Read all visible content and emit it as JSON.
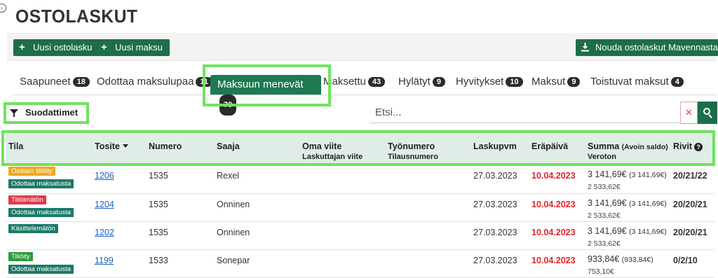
{
  "page": {
    "title": "OSTOLASKUT"
  },
  "toolbar": {
    "new_invoice": "Uusi ostolasku",
    "new_payment": "Uusi maksu",
    "fetch_label": "Nouda ostolaskut Mavennasta"
  },
  "tabs": [
    {
      "label": "Saapuneet",
      "count": "18"
    },
    {
      "label": "Odottaa maksulupaa",
      "count": "11"
    },
    {
      "label": "Maksuun menevät",
      "count": "70"
    },
    {
      "label": "Maksettu",
      "count": "43"
    },
    {
      "label": "Hylätyt",
      "count": "9"
    },
    {
      "label": "Hyvitykset",
      "count": "10"
    },
    {
      "label": "Maksut",
      "count": "9"
    },
    {
      "label": "Toistuvat maksut",
      "count": "4"
    }
  ],
  "filter": {
    "label": "Suodattimet"
  },
  "search": {
    "placeholder": "Etsi..."
  },
  "columns": {
    "tila": "Tila",
    "tosite": "Tosite",
    "numero": "Numero",
    "saaja": "Saaja",
    "oma_viite": "Oma viite",
    "laskuttajan_viite": "Laskuttajan viite",
    "tyonumero": "Työnumero",
    "tilausnumero": "Tilausnumero",
    "laskupvm": "Laskupvm",
    "erapaiva": "Eräpäivä",
    "summa": "Summa",
    "avoin_saldo": "(Avoin saldo)",
    "veroton": "Veroton",
    "rivit": "Rivit"
  },
  "rows": [
    {
      "statuses": [
        {
          "text": "Osittain tiliöity",
          "color": "#f0a81c"
        },
        {
          "text": "Odottaa maksatusta",
          "color": "#1d7a68"
        }
      ],
      "tosite": "1206",
      "numero": "1535",
      "saaja": "Rexel",
      "laskupvm": "27.03.2023",
      "erapaiva": "10.04.2023",
      "summa": "3 141,69€",
      "avoin": "(3 141,69€)",
      "veroton": "2 533,62€",
      "rivit": "20/21/22"
    },
    {
      "statuses": [
        {
          "text": "Tiliöimätön",
          "color": "#e0394a"
        },
        {
          "text": "Odottaa maksatusta",
          "color": "#1d7a68"
        }
      ],
      "tosite": "1204",
      "numero": "1535",
      "saaja": "Onninen",
      "laskupvm": "27.03.2023",
      "erapaiva": "10.04.2023",
      "summa": "3 141,69€",
      "avoin": "(3 141,69€)",
      "veroton": "2 533,62€",
      "rivit": "20/20/21"
    },
    {
      "statuses": [
        {
          "text": "Käsittelemätön",
          "color": "#1d7a68"
        }
      ],
      "tosite": "1202",
      "numero": "1535",
      "saaja": "Onninen",
      "laskupvm": "27.03.2023",
      "erapaiva": "10.04.2023",
      "summa": "3 141,69€",
      "avoin": "(3 141,69€)",
      "veroton": "2 533,62€",
      "rivit": "20/20/21"
    },
    {
      "statuses": [
        {
          "text": "Tiliöity",
          "color": "#2e9a3e"
        },
        {
          "text": "Odottaa maksatusta",
          "color": "#1d7a68"
        }
      ],
      "tosite": "1199",
      "numero": "1533",
      "saaja": "Sonepar",
      "laskupvm": "27.03.2023",
      "erapaiva": "10.04.2023",
      "summa": "933,84€",
      "avoin": "(933,84€)",
      "veroton": "753,10€",
      "rivit": "0/2/10"
    }
  ],
  "colors": {
    "accent": "#1d6e4a",
    "highlight": "#6fe35e",
    "header_bg": "#dfede6",
    "due_red": "#e0262b",
    "link": "#1a5fc8"
  },
  "icons": {
    "add": "plus-icon",
    "download": "download-icon",
    "filter": "funnel-icon",
    "clear": "close-icon",
    "search": "search-icon",
    "sort": "sort-down-icon",
    "help": "help-icon"
  }
}
